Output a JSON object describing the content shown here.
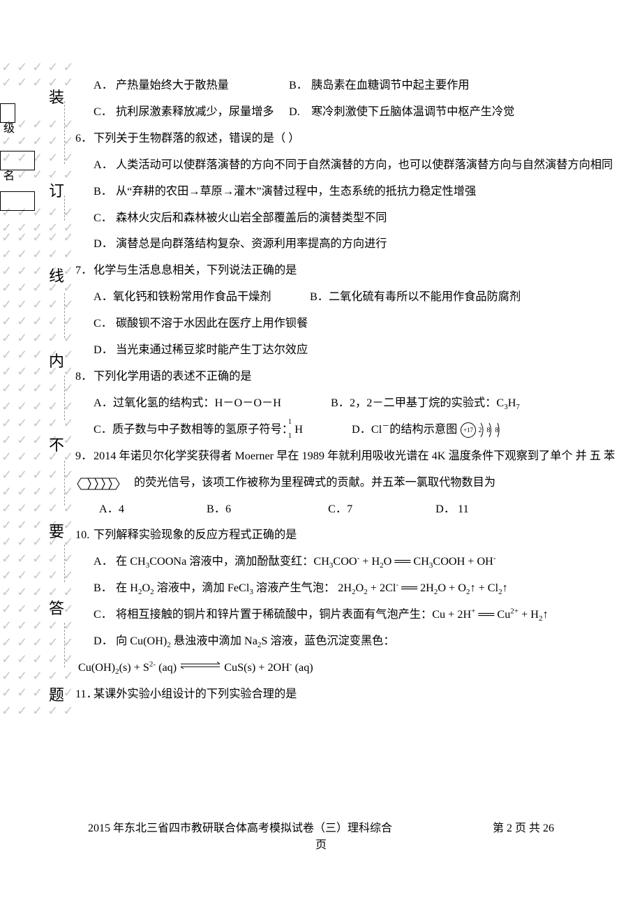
{
  "q5": {
    "A": {
      "l": "A．",
      "v": "产热量始终大于散热量"
    },
    "B": {
      "l": "B．",
      "v": "胰岛素在血糖调节中起主要作用"
    },
    "C": {
      "l": "C．",
      "v": "抗利尿激素释放减少，尿量增多"
    },
    "D": {
      "l": "D.",
      "v": "寒冷刺激使下丘脑体温调节中枢产生冷觉"
    }
  },
  "q6": {
    "num": "6．",
    "stem": "下列关于生物群落的叙述，错误的是（    ）",
    "A": {
      "l": "A．",
      "v": "人类活动可以使群落演替的方向不同于自然演替的方向，也可以使群落演替方向与自然演替方向相同"
    },
    "B": {
      "l": "B．",
      "v": "从“弃耕的农田→草原→灌木”演替过程中，生态系统的抵抗力稳定性增强"
    },
    "C": {
      "l": "C．",
      "v": "森林火灾后和森林被火山岩全部覆盖后的演替类型不同"
    },
    "D": {
      "l": "D．",
      "v": "演替总是向群落结构复杂、资源利用率提高的方向进行"
    }
  },
  "q7": {
    "num": "7．",
    "stem": "化学与生活息息相关，下列说法正确的是",
    "A": {
      "l": "A．",
      "v": "氧化钙和铁粉常用作食品干燥剂"
    },
    "B": {
      "l": "B．",
      "v": "二氧化硫有毒所以不能用作食品防腐剂"
    },
    "C": {
      "l": "C．",
      "v": "碳酸钡不溶于水因此在医疗上用作钡餐"
    },
    "D": {
      "l": "D．",
      "v": "当光束通过稀豆浆时能产生丁达尔效应"
    }
  },
  "q8": {
    "num": "8．",
    "stem": "下列化学用语的表述不正确的是",
    "A": {
      "l": "A．",
      "v": "过氧化氢的结构式：H－O－O－H"
    },
    "B": {
      "l": "B．",
      "v_pre": "2，2－二甲基丁烷的实验式：C",
      "v_suf": "H",
      "s1": "3",
      "s2": "7"
    },
    "C": {
      "l": "C．",
      "v_pre": "质子数与中子数相等的氢原子符号：",
      "H": "H",
      "mass": "1",
      "proton": "1"
    },
    "D": {
      "l": "D．",
      "v_pre": "Cl",
      "sup": "－",
      "v_mid": "的结构示意图",
      "core": "+17",
      "shell1": "2",
      "shell2": "8",
      "shell3": "8"
    }
  },
  "q9": {
    "num": "9．",
    "stem_a": "2014 年诺贝尔化学奖获得者 Moerner 早在 1989 年就利用吸收光谱在 4K 温度条件下观察到了单个 并 五 苯",
    "stem_b": "的荧光信号，该项工作被称为里程碑式的贡献。并五苯一氯取代物数目为",
    "A": {
      "l": "A．",
      "v": "4"
    },
    "B": {
      "l": "B．",
      "v": "6"
    },
    "C": {
      "l": "C．",
      "v": "7"
    },
    "D": {
      "l": "D．",
      "v": "  11"
    }
  },
  "q10": {
    "num": "10.",
    "stem": "下列解释实验现象的反应方程式正确的是",
    "A": {
      "l": "A．",
      "pre": "在 CH",
      "s1": "3",
      "mid": "COONa 溶液中，滴加酚酞变红：CH",
      "s2": "3",
      "eq": "COO",
      "sup1": "-",
      "plus": " + H",
      "s3": "2",
      "o": "O ══ CH",
      "s4": "3",
      "rest": "COOH + OH",
      "sup2": "-"
    },
    "B": {
      "l": "B．",
      "pre": "在 H",
      "s1": "2",
      "o1": "O",
      "s2": "2",
      " ": " 溶液中，滴加 FeCl",
      "s3": "3",
      " 2": " 溶液产生气泡： 2H",
      "s4": "2",
      "o2": "O",
      "s5": "2",
      "plus": " + 2Cl",
      "sup1": "-",
      "eq": " ══ 2H",
      "s6": "2",
      "o3": "O + O",
      "s7": "2",
      "up1": "↑ + Cl",
      "s8": "2",
      "up2": "↑"
    },
    "C": {
      "l": "C．",
      "pre": "将相互接触的铜片和锌片置于稀硫酸中，铜片表面有气泡产生：Cu + 2H",
      "sup1": "+",
      "eq": " ══ Cu",
      "sup2": "2+",
      "rest": " + H",
      "s1": "2",
      "up": "↑"
    },
    "D": {
      "l": "D．",
      "pre": "向 Cu(OH)",
      "s1": "2",
      " ": " 悬浊液中滴加 Na",
      "s2": "2",
      "s": "S 溶液，蓝色沉淀变黑色："
    },
    "Deq": {
      "pre": "Cu(OH)",
      "s1": "2",
      "a": "(s) + S",
      "sup1": "2-",
      "aq": " (aq)",
      "arrow": "⇌",
      "b": "CuS(s) + 2OH",
      "sup2": "-",
      "aq2": " (aq)"
    }
  },
  "q11": {
    "num": "11．",
    "stem": "某课外实验小组设计的下列实验合理的是"
  },
  "seal_chars": [
    "装",
    "订",
    "线",
    "内",
    "不",
    "要",
    "答",
    "题"
  ],
  "left_labels": {
    "a": "级",
    "b": "名"
  },
  "footer": {
    "left": "2015 年东北三省四市教研联合体高考模拟试卷（三）理科综合",
    "right_pre": "第 ",
    "pg": "2",
    "right_mid": " 页 共 ",
    "total": "26",
    "right_suf": "页"
  }
}
